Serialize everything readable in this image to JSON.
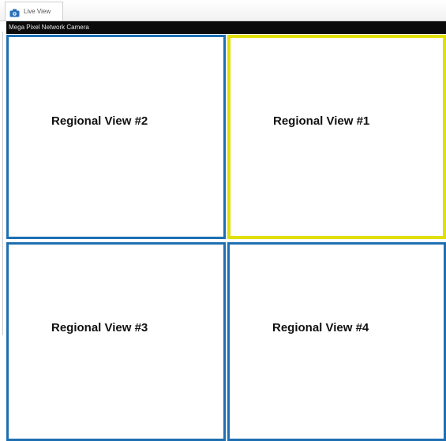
{
  "tabs": [
    {
      "label": "Live View",
      "icon": "camera-icon"
    }
  ],
  "window": {
    "title": "Mega Pixel Network Camera"
  },
  "views": {
    "top_left": {
      "label": "Regional View #2",
      "selected": false
    },
    "top_right": {
      "label": "Regional View #1",
      "selected": true
    },
    "bottom_left": {
      "label": "Regional View #3",
      "selected": false
    },
    "bottom_right": {
      "label": "Regional View #4",
      "selected": false
    }
  },
  "colors": {
    "view_border": "#1e6fb2",
    "selected_border": "#e1df08",
    "title_bar": "#0a0a0a"
  }
}
